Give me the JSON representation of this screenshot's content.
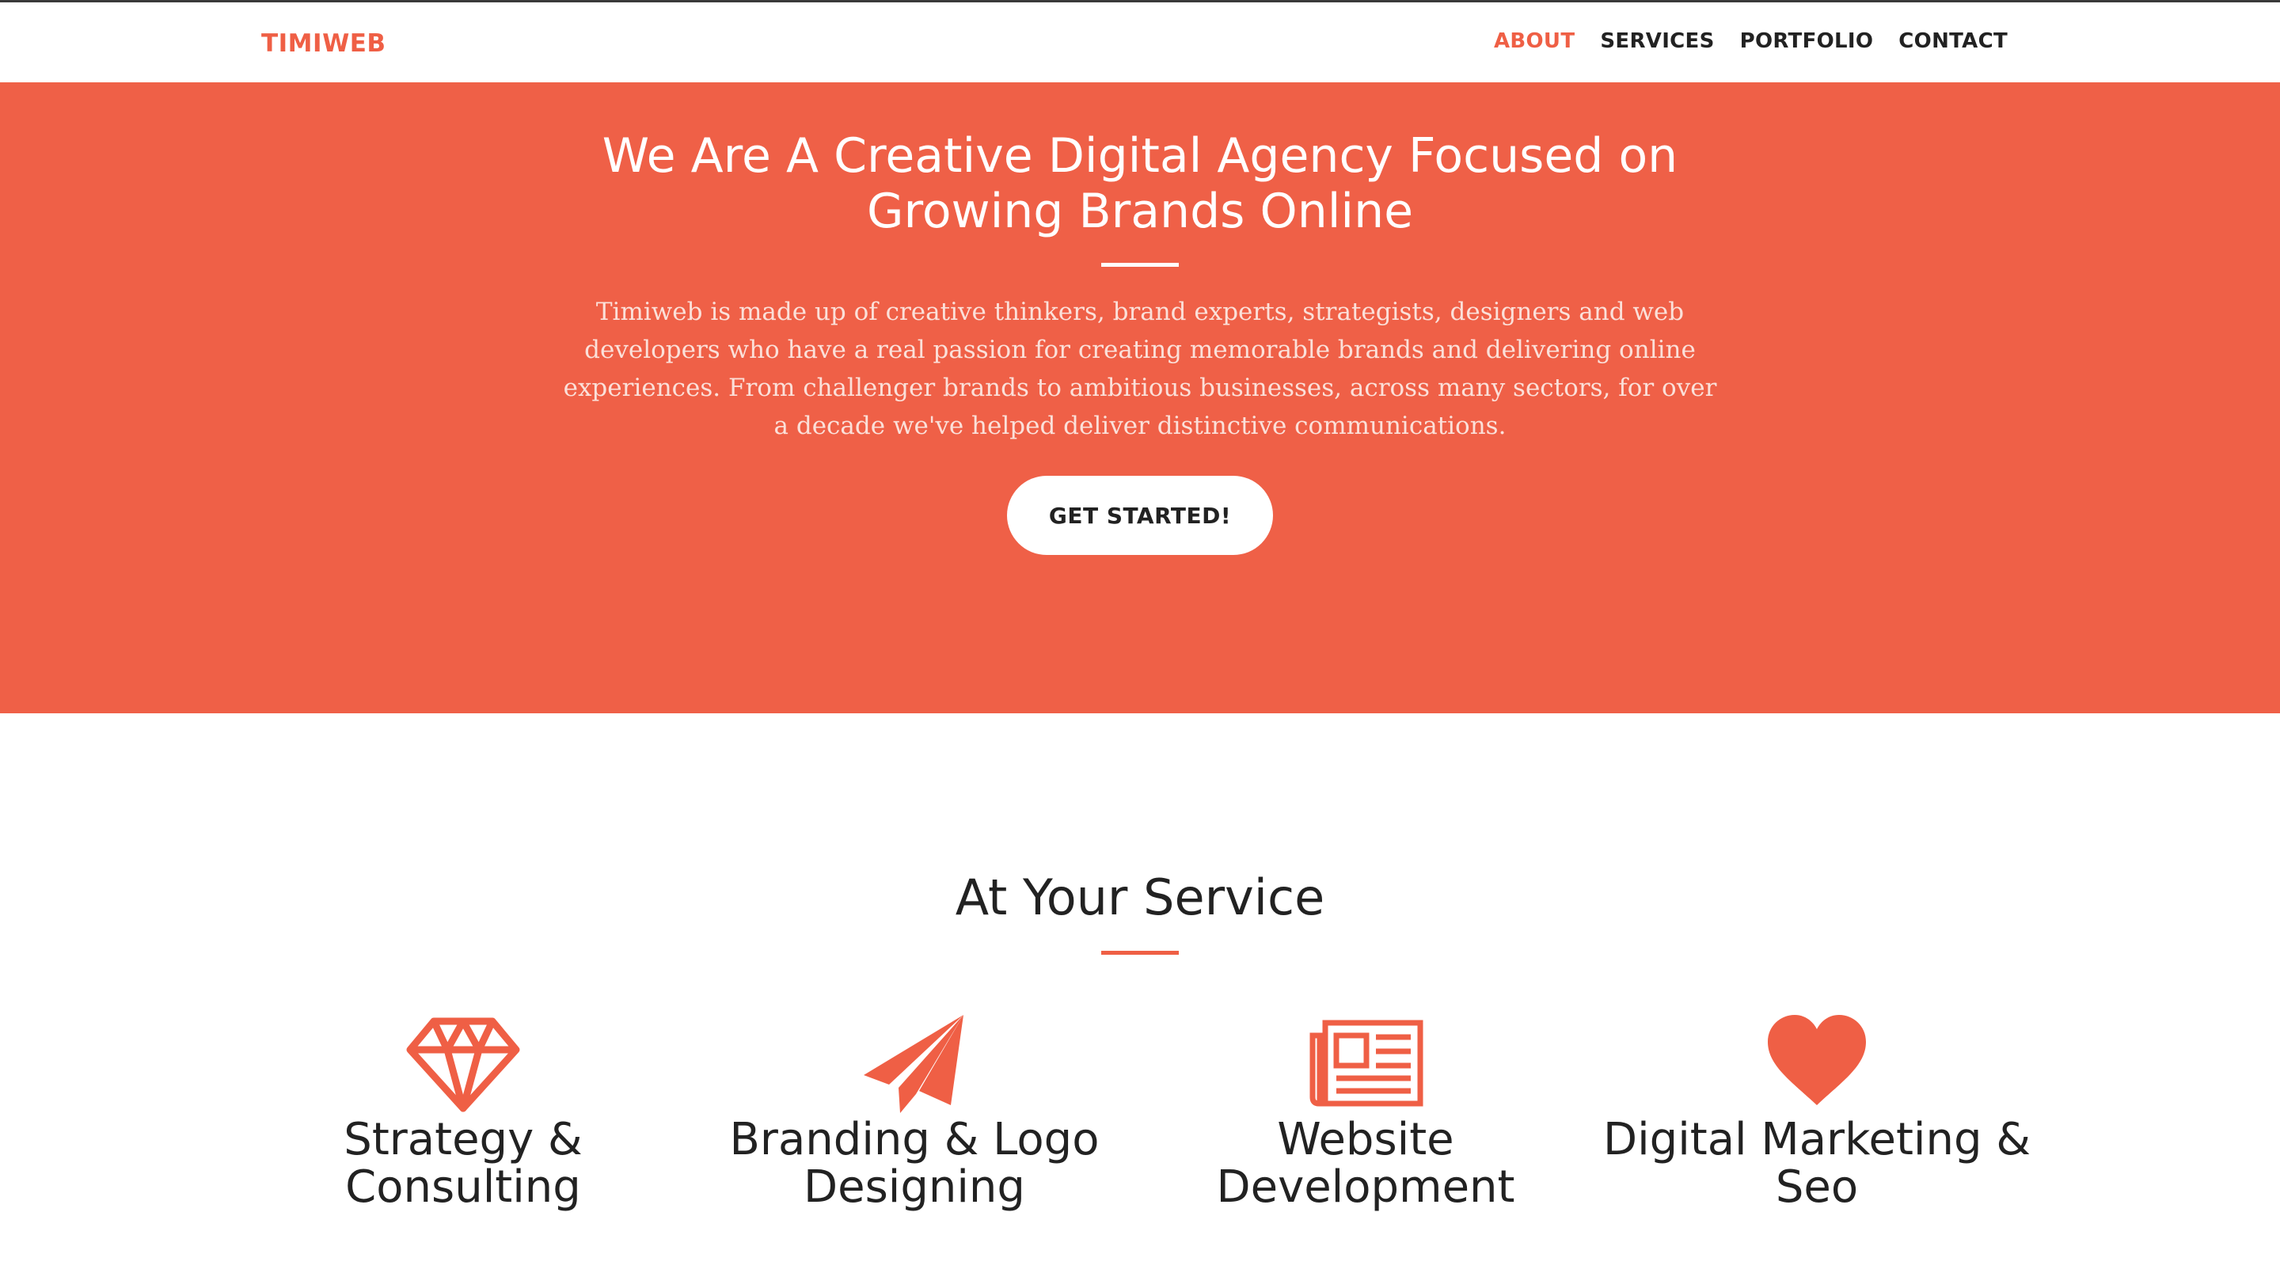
{
  "navbar": {
    "brand": "TIMIWEB",
    "links": [
      {
        "label": "ABOUT",
        "active": true
      },
      {
        "label": "SERVICES",
        "active": false
      },
      {
        "label": "PORTFOLIO",
        "active": false
      },
      {
        "label": "CONTACT",
        "active": false
      }
    ]
  },
  "hero": {
    "title": "We Are A Creative Digital Agency Focused on Growing Brands Online",
    "text": "Timiweb is made up of creative thinkers, brand experts, strategists, designers and web developers who have a real passion for creating memorable brands and delivering online experiences. From challenger brands to ambitious businesses, across many sectors, for over a decade we've helped deliver distinctive communications.",
    "cta_label": "GET STARTED!"
  },
  "services": {
    "title": "At Your Service",
    "items": [
      {
        "icon": "diamond-icon",
        "title": "Strategy & Consulting"
      },
      {
        "icon": "paper-plane-icon",
        "title": "Branding & Logo Designing"
      },
      {
        "icon": "newspaper-icon",
        "title": "Website Development"
      },
      {
        "icon": "heart-icon",
        "title": "Digital Marketing & Seo"
      }
    ]
  },
  "colors": {
    "accent": "#ef5f45",
    "hero_background": "#ef6047",
    "text_dark": "#222222",
    "white": "#ffffff"
  }
}
